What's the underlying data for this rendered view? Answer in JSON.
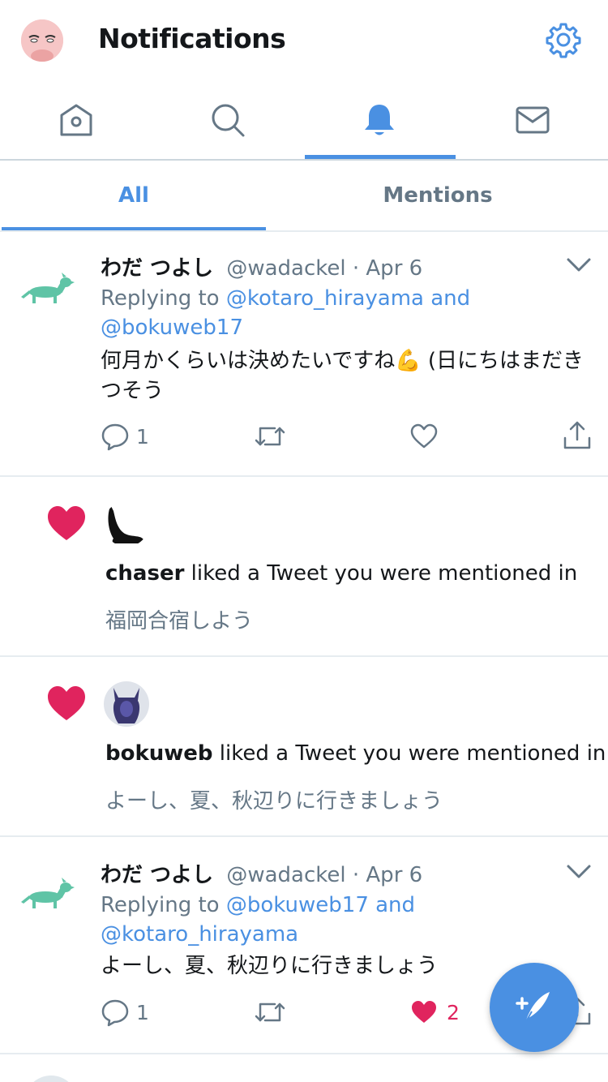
{
  "header": {
    "title": "Notifications"
  },
  "nav": {
    "items": [
      "home-icon",
      "search-icon",
      "bell-icon",
      "mail-icon"
    ],
    "active": "bell-icon"
  },
  "tabs": {
    "all": "All",
    "mentions": "Mentions",
    "active": "All"
  },
  "colors": {
    "accent": "#4a90e2",
    "like": "#e0245e",
    "muted": "#657786",
    "text": "#14171a"
  },
  "feed": [
    {
      "type": "tweet",
      "name": "わだ つよし",
      "meta": "@wadackel · Apr 6",
      "reply_prefix": "Replying to ",
      "reply_handles": "@kotaro_hirayama and @bokuweb17",
      "text": "何月かくらいは決めたいですね💪 (日にちはまだきつそう",
      "reply_count": "1",
      "like_count": ""
    },
    {
      "type": "like",
      "user": "chaser",
      "action": " liked a Tweet you were mentioned in",
      "tweet": "福岡合宿しよう"
    },
    {
      "type": "like",
      "user": "bokuweb",
      "action": " liked a Tweet you were mentioned in",
      "tweet": "よーし、夏、秋辺りに行きましょう"
    },
    {
      "type": "tweet",
      "name": "わだ つよし",
      "meta": "@wadackel · Apr 6",
      "reply_prefix": "Replying to ",
      "reply_handles": "@bokuweb17 and @kotaro_hirayama",
      "text": "よーし、夏、秋辺りに行きましょう",
      "reply_count": "1",
      "like_count": "2"
    }
  ]
}
